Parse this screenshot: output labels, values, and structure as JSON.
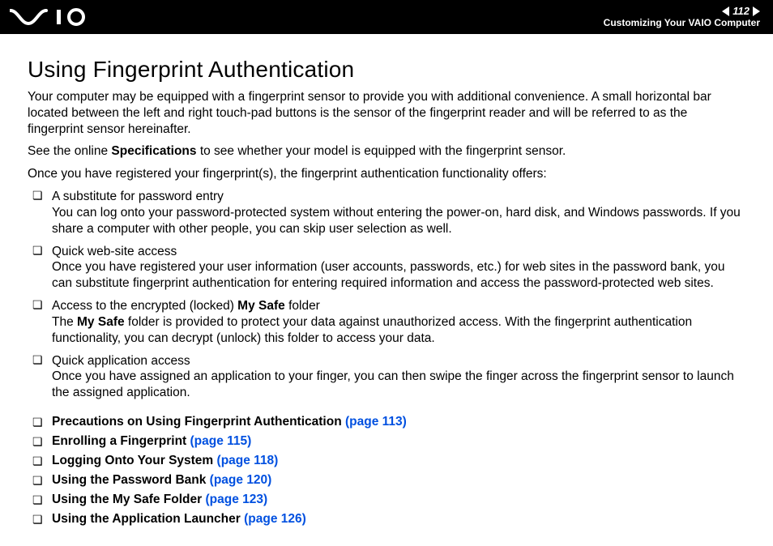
{
  "header": {
    "page_number": "112",
    "section": "Customizing Your VAIO Computer"
  },
  "title": "Using Fingerprint Authentication",
  "intro": {
    "p1": "Your computer may be equipped with a fingerprint sensor to provide you with additional convenience. A small horizontal bar located between the left and right touch-pad buttons is the sensor of the fingerprint reader and will be referred to as the fingerprint sensor hereinafter.",
    "p2_a": "See the online ",
    "p2_b_bold": "Specifications",
    "p2_c": " to see whether your model is equipped with the fingerprint sensor.",
    "p3": "Once you have registered your fingerprint(s), the fingerprint authentication functionality offers:"
  },
  "bullets": [
    {
      "lead": "A substitute for password entry",
      "body": "You can log onto your password-protected system without entering the power-on, hard disk, and Windows passwords. If you share a computer with other people, you can skip user selection as well."
    },
    {
      "lead": "Quick web-site access",
      "body": "Once you have registered your user information (user accounts, passwords, etc.) for web sites in the password bank, you can substitute fingerprint authentication for entering required information and access the password-protected web sites."
    },
    {
      "lead_a": "Access to the encrypted (locked) ",
      "lead_bold": "My Safe",
      "lead_b": " folder",
      "body_a": "The ",
      "body_bold": "My Safe",
      "body_b": " folder is provided to protect your data against unauthorized access. With the fingerprint authentication functionality, you can decrypt (unlock) this folder to access your data."
    },
    {
      "lead": "Quick application access",
      "body": "Once you have assigned an application to your finger, you can then swipe the finger across the fingerprint sensor to launch the assigned application."
    }
  ],
  "links": [
    {
      "label": "Precautions on Using Fingerprint Authentication",
      "page": "(page 113)"
    },
    {
      "label": "Enrolling a Fingerprint",
      "page": "(page 115)"
    },
    {
      "label": "Logging Onto Your System",
      "page": "(page 118)"
    },
    {
      "label": "Using the Password Bank",
      "page": "(page 120)"
    },
    {
      "label": "Using the My Safe Folder",
      "page": "(page 123)"
    },
    {
      "label": "Using the Application Launcher",
      "page": "(page 126)"
    }
  ]
}
